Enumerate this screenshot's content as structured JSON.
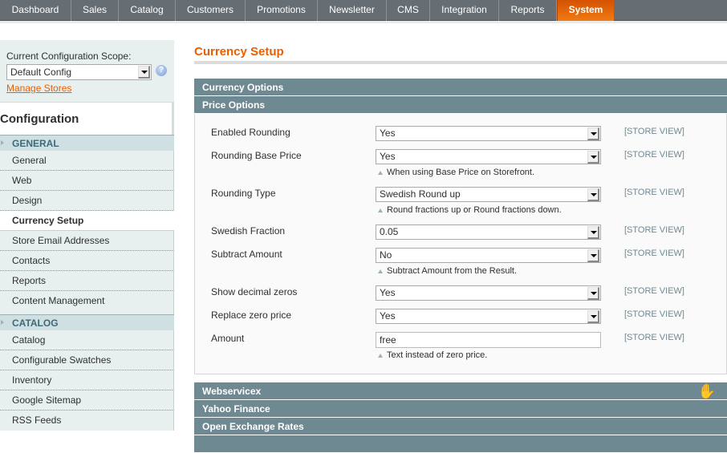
{
  "nav": {
    "items": [
      {
        "label": "Dashboard"
      },
      {
        "label": "Sales"
      },
      {
        "label": "Catalog"
      },
      {
        "label": "Customers"
      },
      {
        "label": "Promotions"
      },
      {
        "label": "Newsletter"
      },
      {
        "label": "CMS"
      },
      {
        "label": "Integration"
      },
      {
        "label": "Reports"
      },
      {
        "label": "System",
        "active": true
      }
    ],
    "active_color": "#eb5e00"
  },
  "sidebar": {
    "scope_label": "Current Configuration Scope:",
    "scope_value": "Default Config",
    "help_icon": "?",
    "manage_stores": "Manage Stores",
    "title": "Configuration",
    "groups": [
      {
        "label": "GENERAL",
        "items": [
          "General",
          "Web",
          "Design",
          "Currency Setup",
          "Store Email Addresses",
          "Contacts",
          "Reports",
          "Content Management"
        ],
        "active": "Currency Setup"
      },
      {
        "label": "CATALOG",
        "items": [
          "Catalog",
          "Configurable Swatches",
          "Inventory",
          "Google Sitemap",
          "RSS Feeds"
        ]
      }
    ]
  },
  "main": {
    "title": "Currency Setup",
    "sections": {
      "currency_options": "Currency Options",
      "price_options": "Price Options",
      "webservicex": "Webservicex",
      "yahoo": "Yahoo Finance",
      "open_exchange": "Open Exchange Rates"
    },
    "fields": [
      {
        "label": "Enabled Rounding",
        "value": "Yes",
        "scope": "[STORE VIEW]"
      },
      {
        "label": "Rounding Base Price",
        "value": "Yes",
        "note": "When using Base Price on Storefront.",
        "scope": "[STORE VIEW]"
      },
      {
        "label": "Rounding Type",
        "value": "Swedish Round up",
        "note": "Round fractions up or Round fractions down.",
        "scope": "[STORE VIEW]"
      },
      {
        "label": "Swedish Fraction",
        "value": "0.05",
        "scope": "[STORE VIEW]"
      },
      {
        "label": "Subtract Amount",
        "value": "No",
        "note": "Subtract Amount from the Result.",
        "scope": "[STORE VIEW]"
      },
      {
        "label": "Show decimal zeros",
        "value": "Yes",
        "scope": "[STORE VIEW]"
      },
      {
        "label": "Replace zero price",
        "value": "Yes",
        "scope": "[STORE VIEW]"
      },
      {
        "label": "Amount",
        "value": "free",
        "note": "Text instead of zero price.",
        "scope": "[STORE VIEW]"
      }
    ]
  }
}
